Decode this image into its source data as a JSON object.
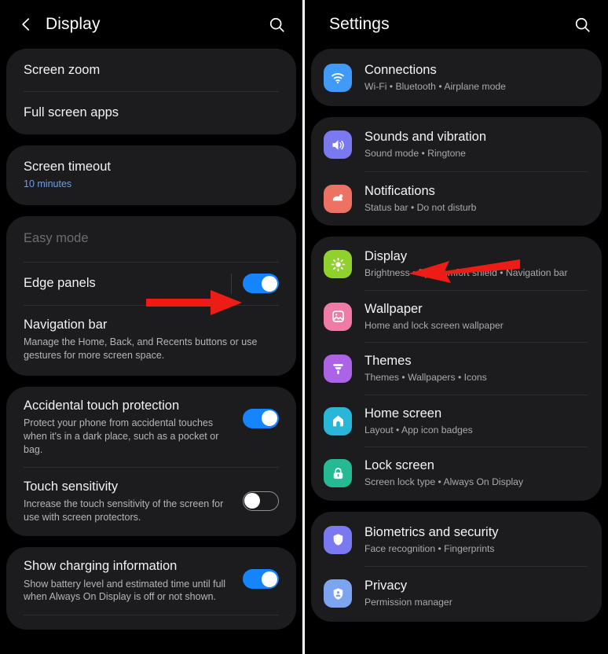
{
  "left_panel": {
    "header": {
      "title": "Display",
      "back_icon": "chevron-left-icon",
      "search_icon": "search-icon"
    },
    "groups": [
      {
        "rows": [
          {
            "title": "Screen zoom",
            "sub": "",
            "toggle": null
          },
          {
            "title": "Full screen apps",
            "sub": "",
            "toggle": null
          }
        ]
      },
      {
        "rows": [
          {
            "title": "Screen timeout",
            "sub": "10 minutes",
            "sub_accent": true,
            "toggle": null
          }
        ]
      },
      {
        "rows": [
          {
            "title": "Easy mode",
            "sub": "",
            "dim": true,
            "toggle": null
          },
          {
            "title": "Edge panels",
            "sub": "",
            "toggle": "on",
            "has_separator": true
          },
          {
            "title": "Navigation bar",
            "sub": "Manage the Home, Back, and Recents buttons or use gestures for more screen space.",
            "toggle": null
          }
        ]
      },
      {
        "rows": [
          {
            "title": "Accidental touch protection",
            "sub": "Protect your phone from accidental touches when it's in a dark place, such as a pocket or bag.",
            "toggle": "on"
          },
          {
            "title": "Touch sensitivity",
            "sub": "Increase the touch sensitivity of the screen for use with screen protectors.",
            "toggle": "off"
          }
        ]
      },
      {
        "rows": [
          {
            "title": "Show charging information",
            "sub": "Show battery level and estimated time until full when Always On Display is off or not shown.",
            "toggle": "on"
          }
        ]
      }
    ]
  },
  "right_panel": {
    "header": {
      "title": "Settings",
      "search_icon": "search-icon"
    },
    "groups": [
      {
        "items": [
          {
            "title": "Connections",
            "sub": "Wi-Fi  •  Bluetooth  •  Airplane mode",
            "icon": "wifi-icon",
            "color": "#3f9bf7"
          }
        ]
      },
      {
        "items": [
          {
            "title": "Sounds and vibration",
            "sub": "Sound mode  •  Ringtone",
            "icon": "speaker-icon",
            "color": "#7b79ef"
          },
          {
            "title": "Notifications",
            "sub": "Status bar  •  Do not disturb",
            "icon": "notification-icon",
            "color": "#ee7264"
          }
        ]
      },
      {
        "items": [
          {
            "title": "Display",
            "sub": "Brightness  •  Eye comfort shield  •  Navigation bar",
            "icon": "brightness-icon",
            "color": "#90d12e"
          },
          {
            "title": "Wallpaper",
            "sub": "Home and lock screen wallpaper",
            "icon": "image-icon",
            "color": "#ef7ba6"
          },
          {
            "title": "Themes",
            "sub": "Themes  •  Wallpapers  •  Icons",
            "icon": "brush-icon",
            "color": "#ad63e6"
          },
          {
            "title": "Home screen",
            "sub": "Layout  •  App icon badges",
            "icon": "home-icon",
            "color": "#2ab6d9"
          },
          {
            "title": "Lock screen",
            "sub": "Screen lock type  •  Always On Display",
            "icon": "lock-icon",
            "color": "#25ba92"
          }
        ]
      },
      {
        "items": [
          {
            "title": "Biometrics and security",
            "sub": "Face recognition  •  Fingerprints",
            "icon": "shield-icon",
            "color": "#7b79ef"
          },
          {
            "title": "Privacy",
            "sub": "Permission manager",
            "icon": "privacy-shield-icon",
            "color": "#7da5ef"
          }
        ]
      }
    ]
  },
  "annotations": {
    "left_arrow": {
      "name": "red-arrow-pointing-right",
      "color": "#ee1c16",
      "target": "Edge panels toggle"
    },
    "right_arrow": {
      "name": "red-arrow-pointing-left",
      "color": "#ee1c16",
      "target": "Display menu item"
    }
  }
}
